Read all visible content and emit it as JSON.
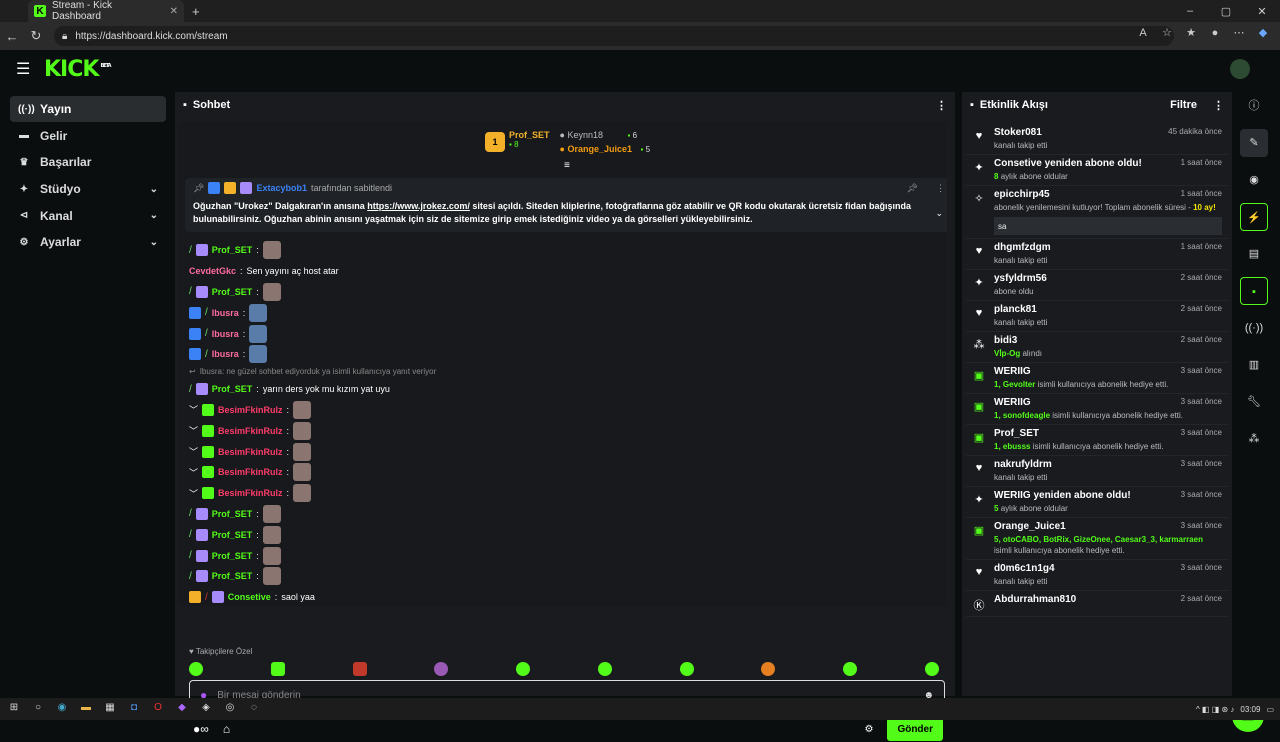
{
  "browser": {
    "tab_title": "Stream - Kick Dashboard",
    "url": "https://dashboard.kick.com/stream"
  },
  "app": {
    "logo": "KICK",
    "logo_sup": "BETA"
  },
  "sidebar": {
    "items": [
      {
        "label": "Yayın",
        "icon": "broadcast-icon",
        "active": true
      },
      {
        "label": "Gelir",
        "icon": "money-icon"
      },
      {
        "label": "Başarılar",
        "icon": "trophy-icon"
      },
      {
        "label": "Stüdyo",
        "icon": "studio-icon",
        "chevron": true
      },
      {
        "label": "Kanal",
        "icon": "channel-icon",
        "chevron": true
      },
      {
        "label": "Ayarlar",
        "icon": "settings-icon",
        "chevron": true
      }
    ]
  },
  "chat": {
    "title": "Sohbet",
    "leaders": {
      "first": {
        "rank": "1",
        "name": "Prof_SET",
        "count": "8"
      },
      "second": {
        "name": "Keynn18",
        "count": "6"
      },
      "third": {
        "name": "Orange_Juice1",
        "count": "5"
      }
    },
    "pinned": {
      "by": "Extacybob1",
      "suffix": "tarafından sabitlendi",
      "text_before": "Oğuzhan \"Urokez\" Dalgakıran'ın anısına ",
      "link": "https://www.jrokez.com/",
      "text_after": " sitesi açıldı. Siteden kliplerine, fotoğraflarına göz atabilir ve QR kodu okutarak ücretsiz fidan bağışında bulunabilirsiniz. Oğuzhan abinin anısını yaşatmak için siz de sitemize girip emek istediğiniz video ya da görselleri yükleyebilirsiniz."
    },
    "messages": [
      {
        "user": "Prof_SET",
        "text": "",
        "color": "green"
      },
      {
        "user": "CevdetGkc",
        "text": "Sen yayını aç host atar",
        "color": "pink"
      },
      {
        "user": "Prof_SET",
        "text": "",
        "color": "green"
      },
      {
        "user": "Ibusra",
        "text": "",
        "color": "pink"
      },
      {
        "user": "Ibusra",
        "text": "",
        "color": "pink"
      },
      {
        "user": "Ibusra",
        "text": "",
        "color": "pink"
      }
    ],
    "reply_line": "Ibusra: ne güzel sohbet ediyorduk ya isimli kullanıcıya yanıt veriyor",
    "messages2": [
      {
        "user": "Prof_SET",
        "text": "yarın ders yok mu kızım yat uyu",
        "color": "green"
      },
      {
        "user": "BesimFkinRulz",
        "text": "",
        "color": "red"
      },
      {
        "user": "BesimFkinRulz",
        "text": "",
        "color": "red"
      },
      {
        "user": "BesimFkinRulz",
        "text": "",
        "color": "red"
      },
      {
        "user": "BesimFkinRulz",
        "text": "",
        "color": "red"
      },
      {
        "user": "BesimFkinRulz",
        "text": "",
        "color": "red"
      },
      {
        "user": "Prof_SET",
        "text": "",
        "color": "green"
      },
      {
        "user": "Prof_SET",
        "text": "",
        "color": "green"
      },
      {
        "user": "Prof_SET",
        "text": "",
        "color": "green"
      },
      {
        "user": "Prof_SET",
        "text": "",
        "color": "green"
      },
      {
        "user": "Consetive",
        "text": "saol yaa",
        "color": "green"
      }
    ],
    "follower_only": "Takipçilere Özel",
    "input_placeholder": "Bir mesaj gönderin",
    "send_label": "Gönder"
  },
  "activity": {
    "title": "Etkinlik Akışı",
    "filter_label": "Filtre",
    "items": [
      {
        "icon": "heart-icon",
        "name": "Stoker081",
        "time": "45 dakika önce",
        "desc": "kanalı takip etti"
      },
      {
        "icon": "star-icon",
        "name": "Consetive yeniden abone oldu!",
        "time": "1 saat önce",
        "hl": "8",
        "desc": "aylık abone oldular"
      },
      {
        "icon": "sparkle-icon",
        "name": "epicchirp45",
        "time": "1 saat önce",
        "desc": "abonelik yenilemesini kutluyor! Toplam abonelik süresi -",
        "hl_after": "10 ay!",
        "box": "sa"
      },
      {
        "icon": "heart-icon",
        "name": "dhgmfzdgm",
        "time": "1 saat önce",
        "desc": "kanalı takip etti"
      },
      {
        "icon": "star-icon",
        "name": "ysfyldrm56",
        "time": "2 saat önce",
        "desc": "abone oldu"
      },
      {
        "icon": "heart-icon",
        "name": "planck81",
        "time": "2 saat önce",
        "desc": "kanalı takip etti"
      },
      {
        "icon": "dots-icon",
        "name": "bidi3",
        "time": "2 saat önce",
        "hl": "Vİp-Og",
        "desc": "alındı"
      },
      {
        "icon": "gift-icon",
        "name": "WERIIG",
        "time": "3 saat önce",
        "hl": "1, Gevolter",
        "desc": "isimli kullanıcıya abonelik hediye etti."
      },
      {
        "icon": "gift-icon",
        "name": "WERIIG",
        "time": "3 saat önce",
        "hl": "1, sonofdeagle",
        "desc": "isimli kullanıcıya abonelik hediye etti."
      },
      {
        "icon": "gift-icon",
        "name": "Prof_SET",
        "time": "3 saat önce",
        "hl": "1, ebusss",
        "desc": "isimli kullanıcıya abonelik hediye etti."
      },
      {
        "icon": "heart-icon",
        "name": "nakrufyldrm",
        "time": "3 saat önce",
        "desc": "kanalı takip etti"
      },
      {
        "icon": "star-icon",
        "name": "WERIIG yeniden abone oldu!",
        "time": "3 saat önce",
        "hl": "5",
        "desc": "aylık abone oldular"
      },
      {
        "icon": "gift-icon",
        "name": "Orange_Juice1",
        "time": "3 saat önce",
        "hl": "5, otoCABO, BotRix, GizeOnee, Caesar3_3, karmarraen",
        "desc": "isimli kullanıcıya abonelik hediye etti."
      },
      {
        "icon": "heart-icon",
        "name": "d0m6c1n1g4",
        "time": "3 saat önce",
        "desc": "kanalı takip etti"
      },
      {
        "icon": "kick-icon",
        "name": "Abdurrahman810",
        "time": "2 saat önce",
        "desc": ""
      }
    ]
  },
  "taskbar": {
    "time": "03:09"
  }
}
